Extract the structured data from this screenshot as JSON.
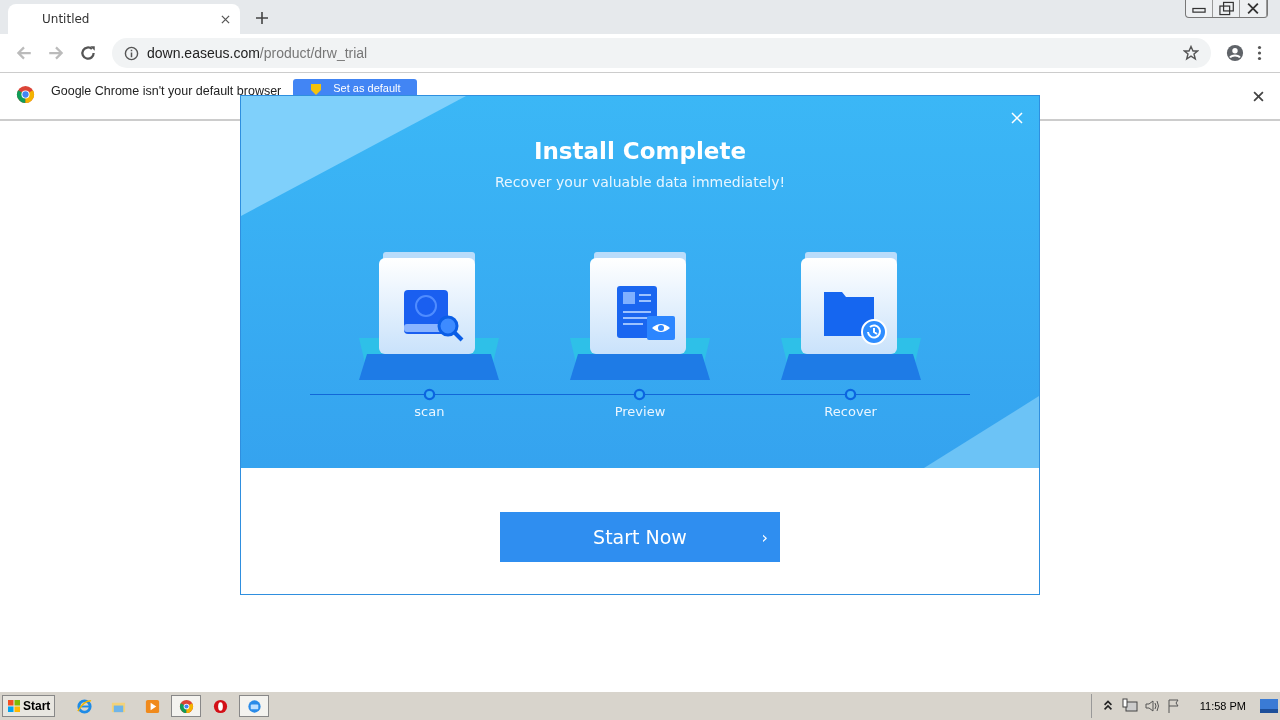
{
  "browser": {
    "tab": {
      "title": "Untitled"
    },
    "address": {
      "host": "down.easeus.com",
      "path": "/product/drw_trial"
    },
    "infobar": {
      "message": "Google Chrome isn't your default browser",
      "button": "Set as default"
    }
  },
  "dialog": {
    "title": "Install Complete",
    "subtitle": "Recover your valuable data immediately!",
    "steps": [
      {
        "kind": "scan",
        "label": "scan"
      },
      {
        "kind": "preview",
        "label": "Preview"
      },
      {
        "kind": "recover",
        "label": "Recover"
      }
    ],
    "button": {
      "label": "Start Now",
      "arrow": "›"
    }
  },
  "taskbar": {
    "start": "Start",
    "apps": [
      {
        "kind": "ie",
        "selected": false
      },
      {
        "kind": "explorer",
        "selected": false
      },
      {
        "kind": "media",
        "selected": false
      },
      {
        "kind": "chrome",
        "selected": true
      },
      {
        "kind": "opera",
        "selected": false
      },
      {
        "kind": "setup",
        "selected": true
      }
    ],
    "clock": "11:58 PM"
  }
}
